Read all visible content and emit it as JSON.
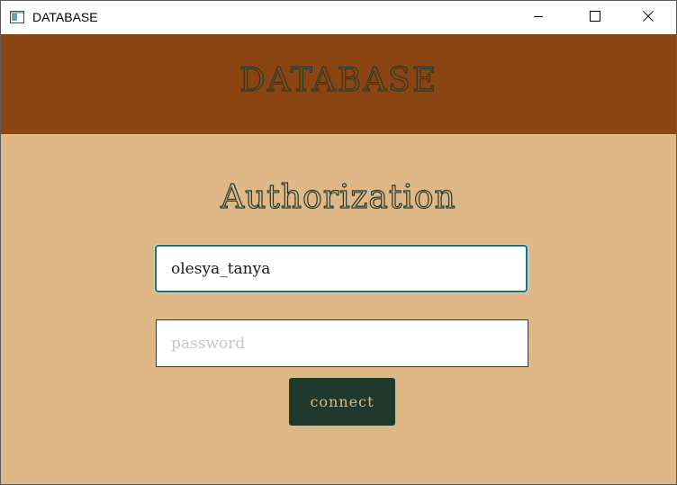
{
  "window": {
    "title": "DATABASE",
    "icon": "app-window-icon",
    "controls": {
      "minimize_icon": "minimize-icon",
      "maximize_icon": "maximize-icon",
      "close_icon": "close-icon"
    }
  },
  "header": {
    "title": "DATABASE"
  },
  "auth": {
    "heading": "Authorization",
    "username": {
      "value": "olesya_tanya",
      "focused": true
    },
    "password": {
      "value": "",
      "placeholder": "password"
    },
    "connect_label": "connect"
  },
  "colors": {
    "header_bg": "#8b4513",
    "main_bg": "#deb887",
    "button_bg": "#1f3a2d",
    "focus_border": "#1f6f7a"
  }
}
